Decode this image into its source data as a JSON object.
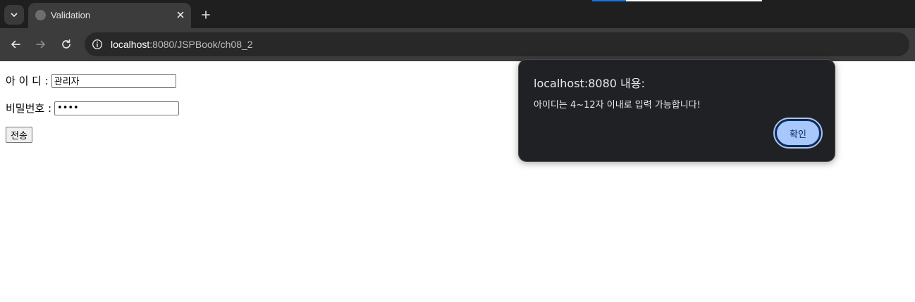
{
  "browser": {
    "tab": {
      "title": "Validation"
    },
    "url": {
      "host": "localhost",
      "rest": ":8080/JSPBook/ch08_2"
    },
    "accent_colors": [
      "#1a73e8",
      "#ffffff"
    ]
  },
  "form": {
    "id_label": "아 이 디 :",
    "id_value": "관리자",
    "password_label": "비밀번호 :",
    "password_value": "••••",
    "submit_label": "전송"
  },
  "alert": {
    "title": "localhost:8080 내용:",
    "message": "아이디는 4~12자 이내로 입력 가능합니다!",
    "ok_label": "확인"
  },
  "icons": {
    "tab_search": "chevron-down-icon",
    "tab_close": "close-icon",
    "new_tab": "plus-icon",
    "back": "arrow-left-icon",
    "forward": "arrow-right-icon",
    "reload": "reload-icon",
    "site_info": "info-icon"
  }
}
